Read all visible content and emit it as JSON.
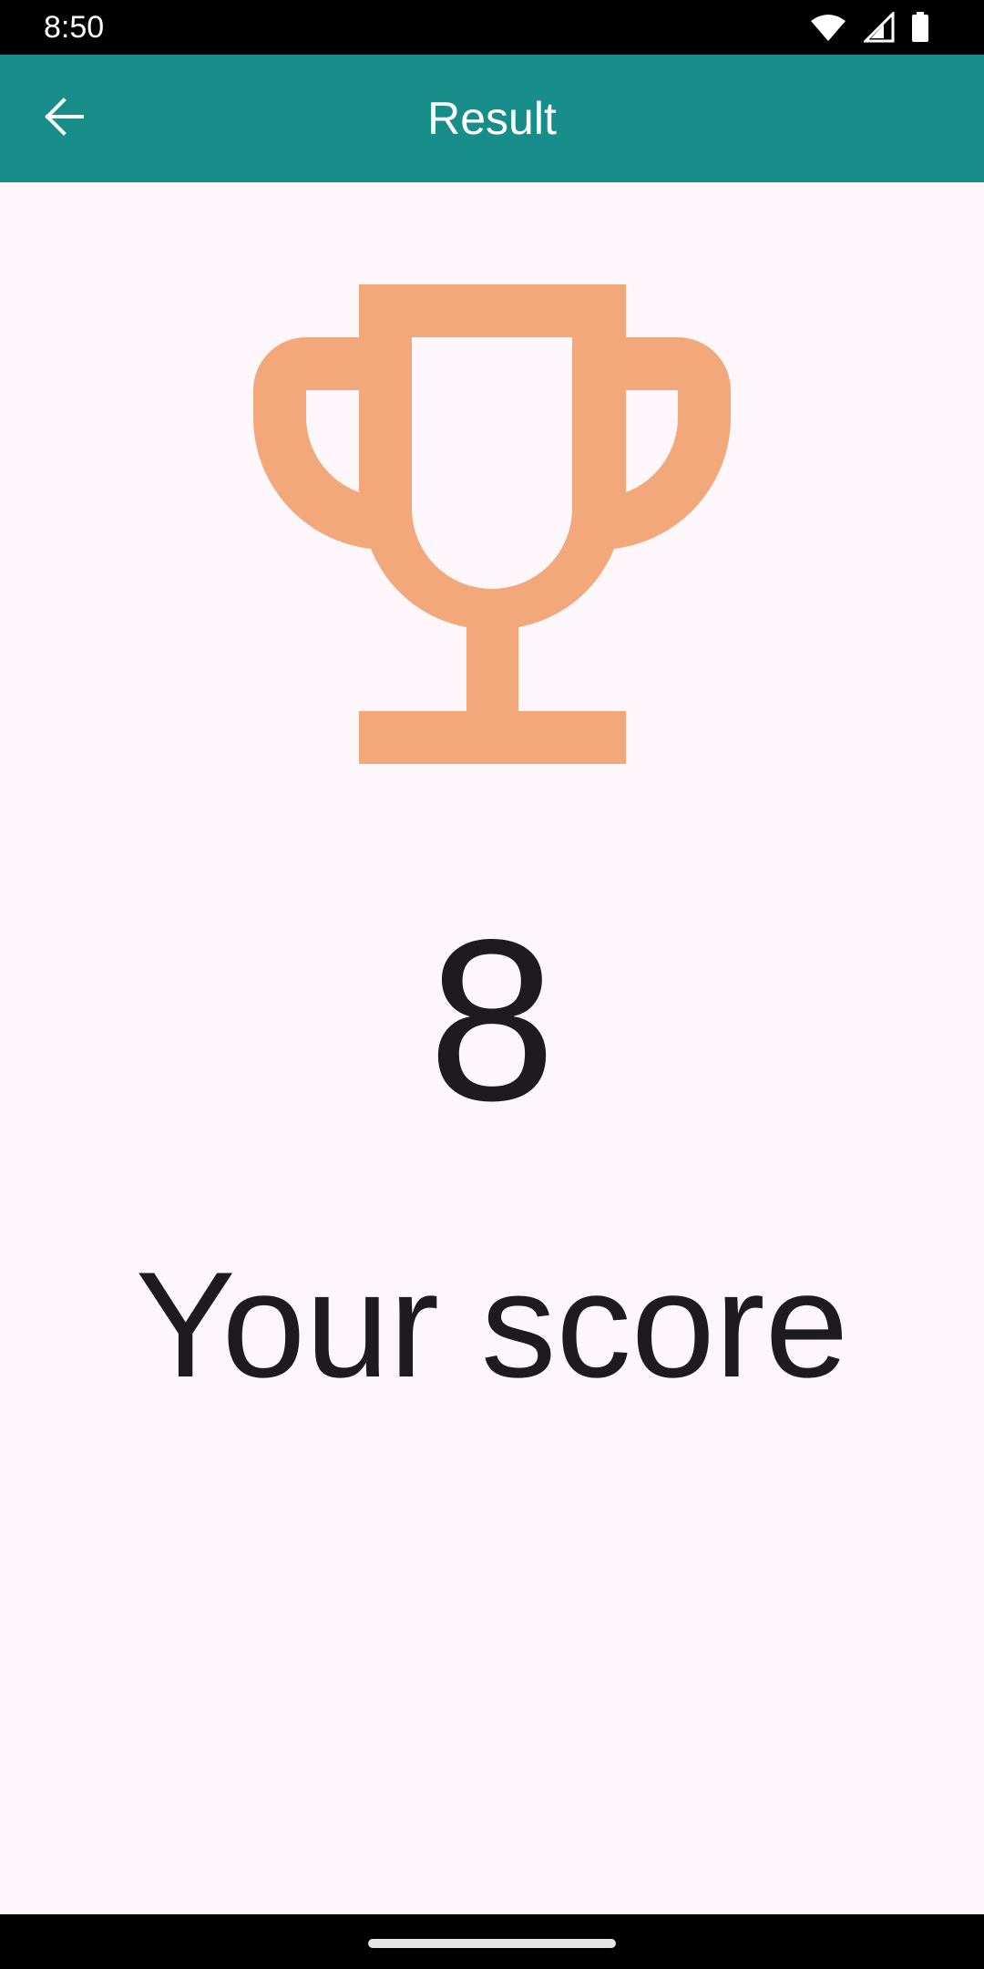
{
  "status_bar": {
    "time": "8:50",
    "icons": [
      "wifi-icon",
      "cellular-signal-icon",
      "battery-icon"
    ]
  },
  "app_bar": {
    "title": "Result",
    "back_icon": "arrow-back-icon",
    "background_color": "#178e89"
  },
  "result": {
    "trophy_icon": "trophy-icon",
    "trophy_color": "#f2a87a",
    "score": "8",
    "score_label": "Your score"
  },
  "nav_bar": {
    "handle": "home-gesture-handle"
  }
}
